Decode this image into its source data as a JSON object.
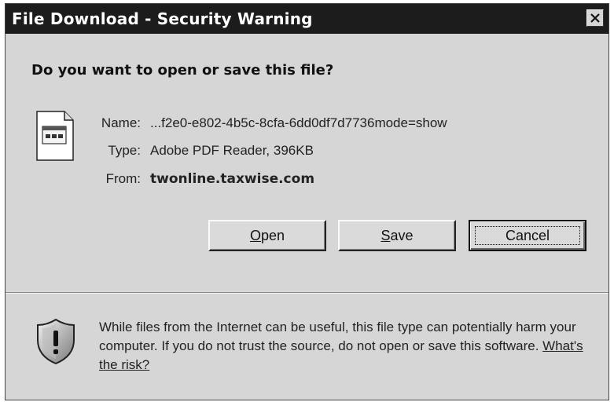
{
  "window": {
    "title": "File Download - Security Warning"
  },
  "dialog": {
    "question": "Do you want to open or save this file?",
    "name_label": "Name:",
    "name_value": "...f2e0-e802-4b5c-8cfa-6dd0df7d7736mode=show",
    "type_label": "Type:",
    "type_value": "Adobe PDF Reader, 396KB",
    "from_label": "From:",
    "from_value": "twonline.taxwise.com"
  },
  "buttons": {
    "open_accel": "O",
    "open_rest": "pen",
    "save_accel": "S",
    "save_rest": "ave",
    "cancel": "Cancel"
  },
  "warning": {
    "text": "While files from the Internet can be useful, this file type can potentially harm your computer. If you do not trust the source, do not open or save this software.",
    "link": "What's the risk?"
  },
  "icons": {
    "close": "close-icon",
    "file": "file-type-icon",
    "shield": "shield-warning-icon"
  },
  "colors": {
    "titlebar": "#1c1c1c",
    "dialog_bg": "#d6d6d6"
  }
}
